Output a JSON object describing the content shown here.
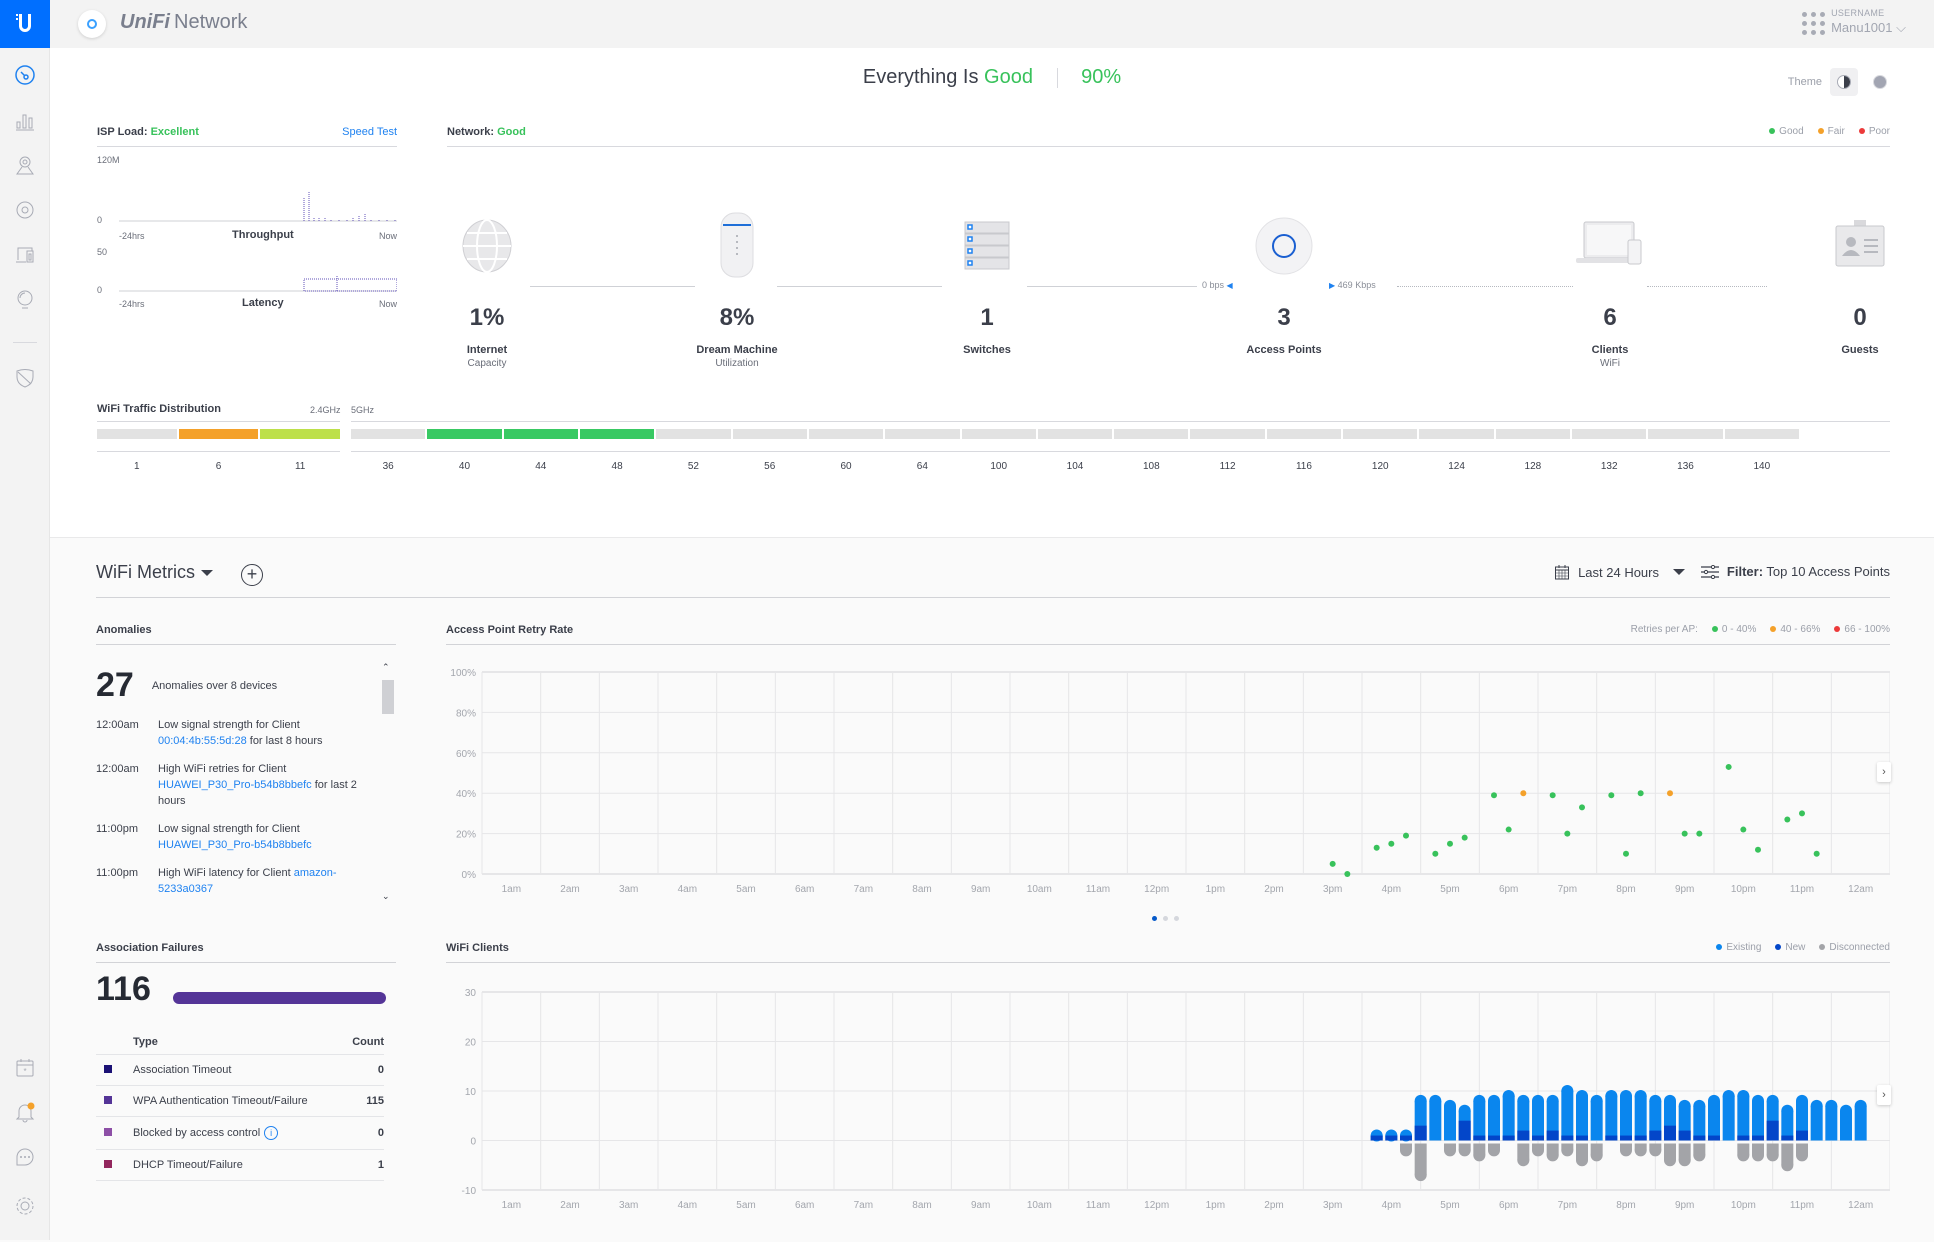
{
  "app": {
    "title_brand": "UniFi",
    "title_product": "Network"
  },
  "user": {
    "label": "USERNAME",
    "name": "Manu1001"
  },
  "sidebar": {
    "items": [
      {
        "name": "dashboard",
        "active": true
      },
      {
        "name": "statistics"
      },
      {
        "name": "map"
      },
      {
        "name": "devices"
      },
      {
        "name": "clients"
      },
      {
        "name": "insights"
      },
      {
        "name": "threat-management"
      }
    ],
    "bottom": [
      {
        "name": "events"
      },
      {
        "name": "alerts",
        "badge": true
      },
      {
        "name": "support-chat"
      },
      {
        "name": "settings"
      }
    ]
  },
  "status": {
    "prefix": "Everything Is",
    "state": "Good",
    "score": "90%"
  },
  "theme": {
    "label": "Theme"
  },
  "isp": {
    "label": "ISP Load:",
    "state": "Excellent",
    "speed_test": "Speed Test",
    "throughput": {
      "title": "Throughput",
      "ymax": "120M",
      "ymin": "0",
      "xstart": "-24hrs",
      "xend": "Now"
    },
    "latency": {
      "title": "Latency",
      "ymax": "50",
      "ymin": "0",
      "xstart": "-24hrs",
      "xend": "Now"
    }
  },
  "network": {
    "label": "Network:",
    "state": "Good",
    "legend": [
      {
        "label": "Good",
        "color": "#38c25b"
      },
      {
        "label": "Fair",
        "color": "#f4a12a"
      },
      {
        "label": "Poor",
        "color": "#ec3a3a"
      }
    ],
    "nodes": [
      {
        "value": "1%",
        "name": "Internet",
        "sub": "Capacity"
      },
      {
        "value": "8%",
        "name": "Dream Machine",
        "sub": "Utilization"
      },
      {
        "value": "1",
        "name": "Switches",
        "sub": ""
      },
      {
        "value": "3",
        "name": "Access Points",
        "sub": ""
      },
      {
        "value": "6",
        "name": "Clients",
        "sub": "WiFi"
      },
      {
        "value": "0",
        "name": "Guests",
        "sub": ""
      }
    ],
    "rates": {
      "uplink": "0 bps",
      "downlink": "469 Kbps"
    }
  },
  "wifi_traffic": {
    "title": "WiFi Traffic Distribution",
    "band24": "2.4GHz",
    "band5": "5GHz",
    "channels24": [
      {
        "ch": "1",
        "color": "#e2e2e2"
      },
      {
        "ch": "6",
        "color": "#f4a12a"
      },
      {
        "ch": "11",
        "color": "#bde04a"
      }
    ],
    "channels5": [
      {
        "ch": "36",
        "color": "#e2e2e2"
      },
      {
        "ch": "40",
        "color": "#38c963"
      },
      {
        "ch": "44",
        "color": "#38c963"
      },
      {
        "ch": "48",
        "color": "#38c963"
      },
      {
        "ch": "52",
        "color": "#e2e2e2"
      },
      {
        "ch": "56",
        "color": "#e2e2e2"
      },
      {
        "ch": "60",
        "color": "#e2e2e2"
      },
      {
        "ch": "64",
        "color": "#e2e2e2"
      },
      {
        "ch": "100",
        "color": "#e2e2e2"
      },
      {
        "ch": "104",
        "color": "#e2e2e2"
      },
      {
        "ch": "108",
        "color": "#e2e2e2"
      },
      {
        "ch": "112",
        "color": "#e2e2e2"
      },
      {
        "ch": "116",
        "color": "#e2e2e2"
      },
      {
        "ch": "120",
        "color": "#e2e2e2"
      },
      {
        "ch": "124",
        "color": "#e2e2e2"
      },
      {
        "ch": "128",
        "color": "#e2e2e2"
      },
      {
        "ch": "132",
        "color": "#e2e2e2"
      },
      {
        "ch": "136",
        "color": "#e2e2e2"
      },
      {
        "ch": "140",
        "color": "#e2e2e2"
      }
    ]
  },
  "metrics": {
    "title": "WiFi Metrics",
    "range": "Last 24 Hours",
    "filter_label": "Filter:",
    "filter_value": "Top 10 Access Points"
  },
  "anomalies": {
    "title": "Anomalies",
    "count": "27",
    "summary": "Anomalies over 8 devices",
    "items": [
      {
        "time": "12:00am",
        "pre": "Low signal strength for Client ",
        "link": "00:04:4b:55:5d:28",
        "post": " for last 8 hours"
      },
      {
        "time": "12:00am",
        "pre": "High WiFi retries for Client ",
        "link": "HUAWEI_P30_Pro-b54b8bbefc",
        "post": " for last 2 hours"
      },
      {
        "time": "11:00pm",
        "pre": "Low signal strength for Client ",
        "link": "HUAWEI_P30_Pro-b54b8bbefc",
        "post": ""
      },
      {
        "time": "11:00pm",
        "pre": "High WiFi latency for Client ",
        "link": "amazon-5233a0367",
        "post": ""
      }
    ]
  },
  "assoc": {
    "title": "Association Failures",
    "total": "116",
    "col_type": "Type",
    "col_count": "Count",
    "rows": [
      {
        "type": "Association Timeout",
        "count": "0",
        "color": "#1b1175"
      },
      {
        "type": "WPA Authentication Timeout/Failure",
        "count": "115",
        "color": "#543497"
      },
      {
        "type": "Blocked by access control",
        "count": "0",
        "color": "#8d4fa6",
        "info": true
      },
      {
        "type": "DHCP Timeout/Failure",
        "count": "1",
        "color": "#92265d"
      }
    ]
  },
  "chart_data": [
    {
      "type": "scatter",
      "title": "Access Point Retry Rate",
      "legend_title": "Retries per AP:",
      "legend": [
        {
          "label": "0 - 40%",
          "color": "#38c25b"
        },
        {
          "label": "40 - 66%",
          "color": "#f4a12a"
        },
        {
          "label": "66 - 100%",
          "color": "#ec3a3a"
        }
      ],
      "ylim": [
        0,
        100
      ],
      "yticks": [
        "0%",
        "20%",
        "40%",
        "60%",
        "80%",
        "100%"
      ],
      "xticks": [
        "1am",
        "2am",
        "3am",
        "4am",
        "5am",
        "6am",
        "7am",
        "8am",
        "9am",
        "10am",
        "11am",
        "12pm",
        "1pm",
        "2pm",
        "3pm",
        "4pm",
        "5pm",
        "6pm",
        "7pm",
        "8pm",
        "9pm",
        "10pm",
        "11pm",
        "12am"
      ],
      "xlim_hours": [
        0.5,
        24.5
      ],
      "points": [
        {
          "h": 15.0,
          "y": 5,
          "c": 0
        },
        {
          "h": 15.25,
          "y": 0,
          "c": 0
        },
        {
          "h": 15.75,
          "y": 13,
          "c": 0
        },
        {
          "h": 16.0,
          "y": 15,
          "c": 0
        },
        {
          "h": 16.25,
          "y": 19,
          "c": 0
        },
        {
          "h": 16.75,
          "y": 10,
          "c": 0
        },
        {
          "h": 17.0,
          "y": 15,
          "c": 0
        },
        {
          "h": 17.25,
          "y": 18,
          "c": 0
        },
        {
          "h": 17.75,
          "y": 39,
          "c": 0
        },
        {
          "h": 18.0,
          "y": 22,
          "c": 0
        },
        {
          "h": 18.25,
          "y": 40,
          "c": 1
        },
        {
          "h": 18.75,
          "y": 39,
          "c": 0
        },
        {
          "h": 19.0,
          "y": 20,
          "c": 0
        },
        {
          "h": 19.25,
          "y": 33,
          "c": 0
        },
        {
          "h": 19.75,
          "y": 39,
          "c": 0
        },
        {
          "h": 20.0,
          "y": 10,
          "c": 0
        },
        {
          "h": 20.25,
          "y": 40,
          "c": 0
        },
        {
          "h": 20.75,
          "y": 40,
          "c": 1
        },
        {
          "h": 21.0,
          "y": 20,
          "c": 0
        },
        {
          "h": 21.25,
          "y": 20,
          "c": 0
        },
        {
          "h": 21.75,
          "y": 53,
          "c": 0
        },
        {
          "h": 22.0,
          "y": 22,
          "c": 0
        },
        {
          "h": 22.25,
          "y": 12,
          "c": 0
        },
        {
          "h": 22.75,
          "y": 27,
          "c": 0
        },
        {
          "h": 23.0,
          "y": 30,
          "c": 0
        },
        {
          "h": 23.25,
          "y": 10,
          "c": 0
        }
      ]
    },
    {
      "type": "bar",
      "title": "WiFi Clients",
      "legend": [
        {
          "label": "Existing",
          "color": "#0a86ee"
        },
        {
          "label": "New",
          "color": "#0346c9"
        },
        {
          "label": "Disconnected",
          "color": "#a3a4a8"
        }
      ],
      "ylim": [
        -10,
        30
      ],
      "yticks": [
        "-10",
        "0",
        "10",
        "20",
        "30"
      ],
      "xticks": [
        "1am",
        "2am",
        "3am",
        "4am",
        "5am",
        "6am",
        "7am",
        "8am",
        "9am",
        "10am",
        "11am",
        "12pm",
        "1pm",
        "2pm",
        "3pm",
        "4pm",
        "5pm",
        "6pm",
        "7pm",
        "8pm",
        "9pm",
        "10pm",
        "11pm",
        "12am"
      ],
      "xlim_hours": [
        0.5,
        24.5
      ],
      "series": [
        {
          "name": "Existing",
          "start_hour": 15.75,
          "step_hours": 0.25,
          "values": [
            1,
            1,
            1,
            8,
            8,
            7,
            6,
            8,
            8,
            9,
            8,
            8,
            8,
            10,
            9,
            8,
            9,
            9,
            9,
            8,
            8,
            7,
            7,
            8,
            9,
            9,
            8,
            8,
            6,
            8,
            7,
            7,
            6,
            7
          ]
        },
        {
          "name": "New",
          "start_hour": 15.75,
          "step_hours": 0.25,
          "values": [
            5,
            1,
            10,
            3,
            0,
            0,
            4,
            1,
            1,
            1,
            2,
            1,
            2,
            1,
            1,
            0,
            1,
            1,
            1,
            2,
            3,
            2,
            1,
            1,
            0,
            1,
            1,
            4,
            1,
            2,
            0,
            0,
            0,
            0
          ]
        },
        {
          "name": "Disconnected",
          "start_hour": 15.75,
          "step_hours": 0.25,
          "values": [
            0,
            0,
            -2,
            -7,
            0,
            -2,
            -2,
            -3,
            -2,
            0,
            -4,
            -2,
            -3,
            -2,
            -4,
            -3,
            0,
            -2,
            -2,
            -2,
            -4,
            -4,
            -3,
            0,
            0,
            -3,
            -3,
            -3,
            -5,
            -3,
            0,
            0,
            0,
            0
          ]
        }
      ]
    }
  ]
}
